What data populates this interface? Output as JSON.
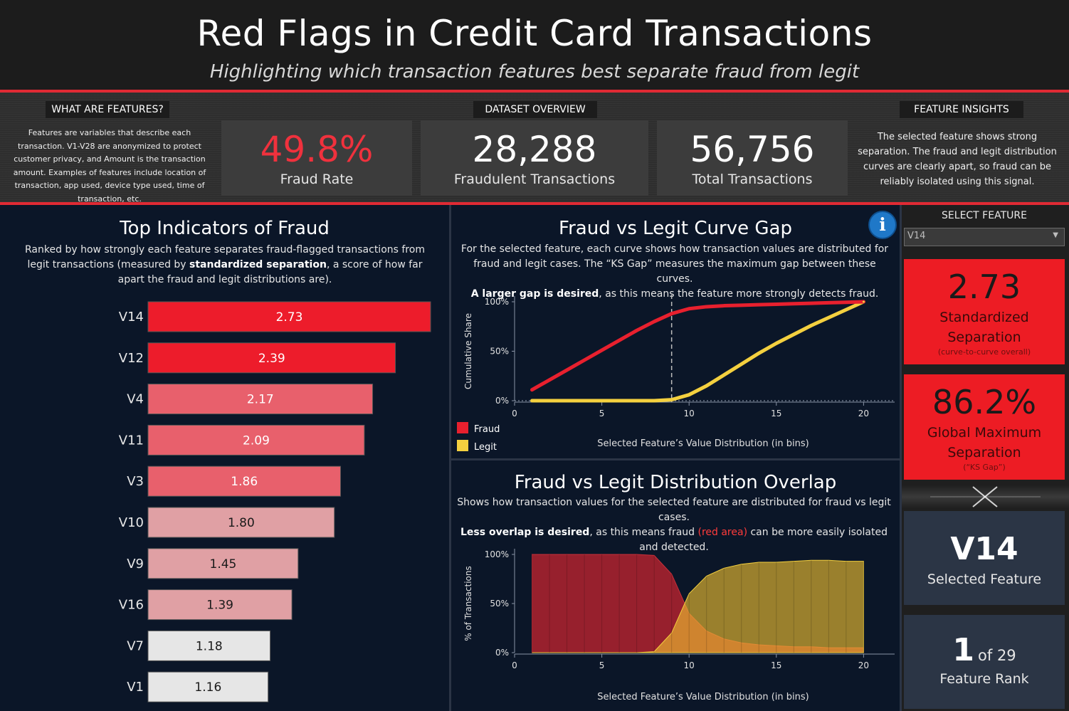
{
  "header": {
    "title": "Red Flags in Credit Card Transactions",
    "subtitle": "Highlighting which transaction features best separate fraud from legit"
  },
  "features_box": {
    "tab": "WHAT ARE FEATURES?",
    "text": "Features are variables that describe each transaction. V1-V28 are anonymized to protect customer privacy, and Amount is the transaction amount. Examples of features include location of transaction, app used, device type used, time of transaction, etc."
  },
  "overview": {
    "tab": "DATASET OVERVIEW",
    "fraud_rate": {
      "value": "49.8%",
      "label": "Fraud Rate"
    },
    "fraudulent": {
      "value": "28,288",
      "label": "Fraudulent Transactions"
    },
    "total": {
      "value": "56,756",
      "label": "Total Transactions"
    }
  },
  "insights": {
    "tab": "FEATURE INSIGHTS",
    "text": "The selected feature shows strong separation. The fraud and legit distribution curves are clearly apart, so fraud can be reliably isolated using this signal."
  },
  "top_indicators": {
    "title": "Top Indicators of Fraud",
    "desc_before": "Ranked by how strongly each feature separates fraud-flagged transactions from legit transactions (measured by ",
    "desc_bold": "standardized separation",
    "desc_after": ", a score of how far apart the fraud and legit distributions are)."
  },
  "curve_gap": {
    "title": "Fraud vs Legit Curve Gap",
    "desc_line1": "For the selected feature, each curve shows how transaction values are distributed for fraud and legit cases. The “KS Gap” measures the maximum gap between these curves.",
    "desc_bold": "A larger gap is desired",
    "desc_after": ", as this means the feature more strongly detects fraud.",
    "ylabel": "Cumulative Share",
    "xlabel": "Selected Feature’s Value Distribution (in bins)",
    "legend_fraud": "Fraud",
    "legend_legit": "Legit",
    "info_icon": "info-icon"
  },
  "overlap": {
    "title": "Fraud vs Legit Distribution Overlap",
    "desc_line1": "Shows how transaction values for the selected feature are distributed for fraud vs legit cases.",
    "desc_bold": "Less overlap is desired",
    "desc_mid": ", as this means fraud ",
    "desc_red": "(red area)",
    "desc_after": " can be more easily isolated and detected.",
    "ylabel": "% of Transactions",
    "xlabel": "Selected Feature’s Value Distribution (in bins)"
  },
  "side": {
    "select_label": "SELECT FEATURE",
    "select_value": "V14",
    "std_sep": {
      "value": "2.73",
      "label": "Standardized Separation",
      "note": "(curve-to-curve overall)"
    },
    "ks": {
      "value": "86.2%",
      "label": "Global Maximum Separation",
      "note": "(“KS Gap”)"
    },
    "selected": {
      "value": "V14",
      "label": "Selected Feature"
    },
    "rank": {
      "value": "1",
      "of": "of 29",
      "label": "Feature Rank"
    }
  },
  "colors": {
    "fraud": "#e8202e",
    "legit": "#f4d03f",
    "bar_high": "#ed1c2b",
    "bar_mid": "#e8606c",
    "bar_low": "#e0a0a4",
    "bar_min": "#e6e6e6",
    "panel_bg": "#0b1628"
  },
  "chart_data": [
    {
      "type": "bar",
      "orientation": "horizontal",
      "title": "Top Indicators of Fraud",
      "categories": [
        "V14",
        "V12",
        "V4",
        "V11",
        "V3",
        "V10",
        "V9",
        "V16",
        "V7",
        "V1"
      ],
      "values": [
        2.73,
        2.39,
        2.17,
        2.09,
        1.86,
        1.8,
        1.45,
        1.39,
        1.18,
        1.16
      ],
      "value_labels": [
        "2.73",
        "2.39",
        "2.17",
        "2.09",
        "1.86",
        "1.80",
        "1.45",
        "1.39",
        "1.18",
        "1.16"
      ]
    },
    {
      "type": "line",
      "title": "Fraud vs Legit Curve Gap",
      "xlabel": "Selected Feature’s Value Distribution (in bins)",
      "ylabel": "Cumulative Share",
      "xlim": [
        0,
        20.8
      ],
      "ylim": [
        0,
        100
      ],
      "xticks": [
        "0",
        "5",
        "10",
        "15",
        "20"
      ],
      "yticks": [
        "0%",
        "50%",
        "100%"
      ],
      "ks_marker_x": 9,
      "series": [
        {
          "name": "Fraud",
          "x": [
            1,
            2,
            3,
            4,
            5,
            6,
            7,
            8,
            9,
            10,
            11,
            12,
            13,
            14,
            15,
            16,
            17,
            18,
            19,
            20
          ],
          "y": [
            11,
            21,
            31,
            41,
            51,
            61,
            71,
            80,
            88,
            93,
            95,
            96,
            96.5,
            97,
            97.5,
            98,
            98.5,
            99,
            99.5,
            100
          ]
        },
        {
          "name": "Legit",
          "x": [
            1,
            2,
            3,
            4,
            5,
            6,
            7,
            8,
            9,
            10,
            11,
            12,
            13,
            14,
            15,
            16,
            17,
            18,
            19,
            20
          ],
          "y": [
            0,
            0,
            0,
            0,
            0,
            0,
            0,
            0,
            1,
            6,
            15,
            26,
            37,
            48,
            58,
            67,
            76,
            84,
            92,
            100
          ]
        }
      ]
    },
    {
      "type": "area",
      "title": "Fraud vs Legit Distribution Overlap",
      "xlabel": "Selected Feature’s Value Distribution (in bins)",
      "ylabel": "% of Transactions",
      "xlim": [
        0,
        20.8
      ],
      "ylim": [
        0,
        100
      ],
      "xticks": [
        "0",
        "5",
        "10",
        "15",
        "20"
      ],
      "yticks": [
        "0%",
        "50%",
        "100%"
      ],
      "series": [
        {
          "name": "Fraud",
          "x": [
            1,
            2,
            3,
            4,
            5,
            6,
            7,
            8,
            9,
            10,
            11,
            12,
            13,
            14,
            15,
            16,
            17,
            18,
            19,
            20
          ],
          "y": [
            100,
            100,
            100,
            100,
            100,
            100,
            100,
            99,
            80,
            40,
            22,
            14,
            10,
            8,
            7,
            6,
            6,
            5,
            5,
            5
          ]
        },
        {
          "name": "Legit",
          "x": [
            1,
            2,
            3,
            4,
            5,
            6,
            7,
            8,
            9,
            10,
            11,
            12,
            13,
            14,
            15,
            16,
            17,
            18,
            19,
            20
          ],
          "y": [
            0,
            0,
            0,
            0,
            0,
            0,
            0,
            1,
            20,
            60,
            78,
            86,
            90,
            92,
            92,
            93,
            94,
            94,
            93,
            93
          ]
        }
      ]
    }
  ]
}
